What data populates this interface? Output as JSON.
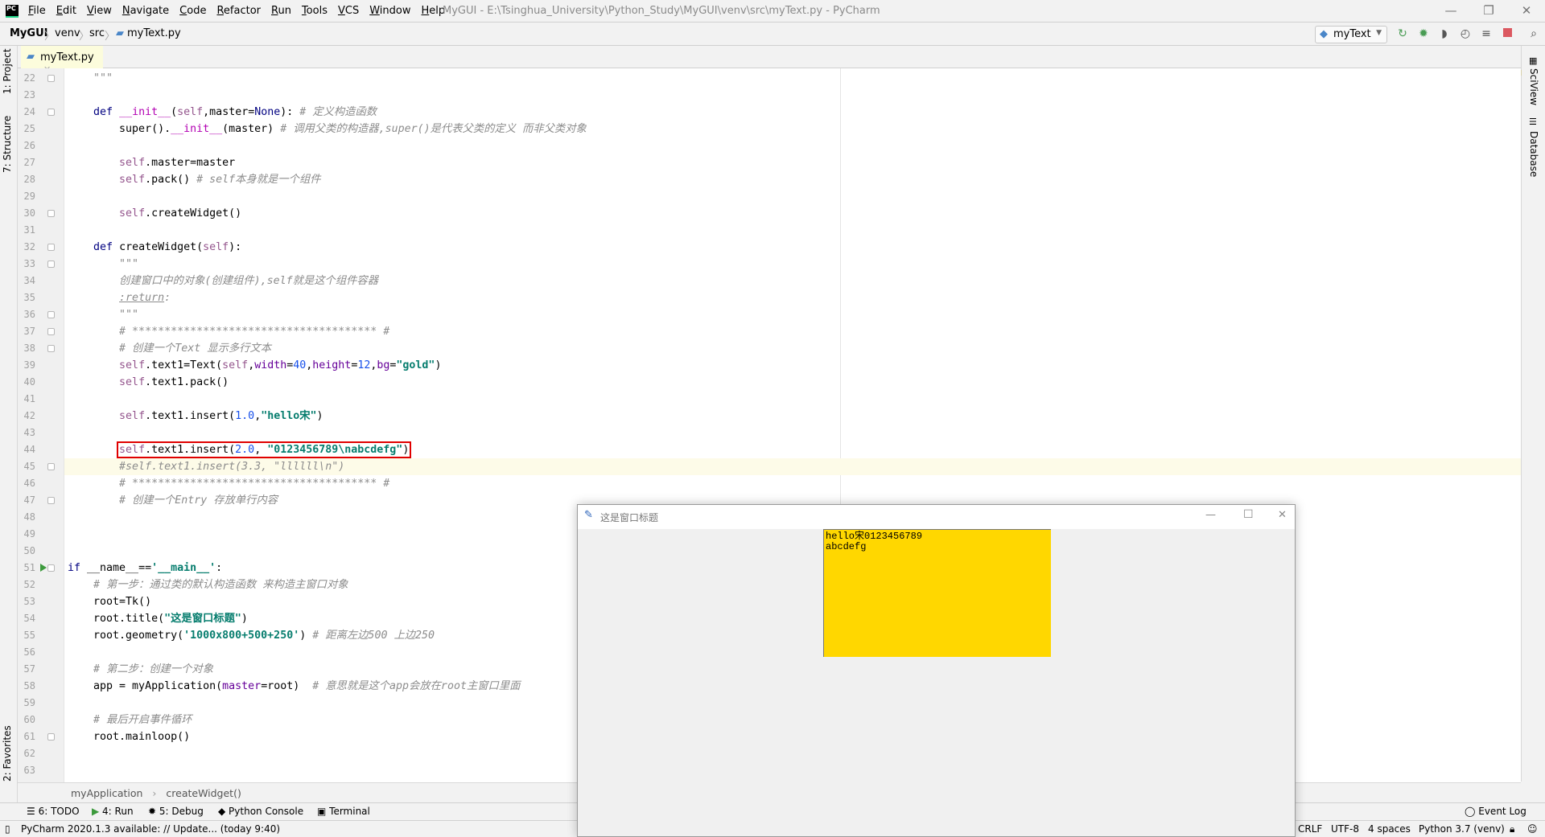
{
  "menubar": {
    "items": [
      "File",
      "Edit",
      "View",
      "Navigate",
      "Code",
      "Refactor",
      "Run",
      "Tools",
      "VCS",
      "Window",
      "Help"
    ],
    "window_title": "MyGUI - E:\\Tsinghua_University\\Python_Study\\MyGUI\\venv\\src\\myText.py - PyCharm"
  },
  "navbar": {
    "breadcrumb": [
      "MyGUI",
      "venv",
      "src",
      "myText.py"
    ],
    "run_config": "myText",
    "icons": [
      "rerun-icon",
      "debug-icon",
      "coverage-icon",
      "profile-icon",
      "concurrency-icon",
      "stop-icon",
      "search-icon"
    ]
  },
  "tab": {
    "label": "myText.py"
  },
  "left_strip": {
    "project": "1: Project",
    "structure": "7: Structure",
    "favorites": "2: Favorites"
  },
  "right_strip": {
    "sciview": "SciView",
    "database": "Database"
  },
  "editor": {
    "current_line": 45,
    "highlighted_line": 44,
    "lines": [
      {
        "n": 22,
        "fold": true,
        "tokens": [
          [
            "doc",
            "    \"\"\""
          ]
        ]
      },
      {
        "n": 23,
        "tokens": []
      },
      {
        "n": 24,
        "fold": true,
        "tokens": [
          [
            "",
            "    "
          ],
          [
            "kw",
            "def"
          ],
          [
            "",
            " "
          ],
          [
            "dunder",
            "__init__"
          ],
          [
            "",
            "("
          ],
          [
            "self",
            "self"
          ],
          [
            "",
            ",master="
          ],
          [
            "none",
            "None"
          ],
          [
            "",
            "): "
          ],
          [
            "cmt",
            "# 定义构造函数"
          ]
        ]
      },
      {
        "n": 25,
        "tokens": [
          [
            "",
            "        super()."
          ],
          [
            "dunder",
            "__init__"
          ],
          [
            "",
            "(master) "
          ],
          [
            "cmt",
            "# 调用父类的构造器,super()是代表父类的定义 而非父类对象"
          ]
        ]
      },
      {
        "n": 26,
        "tokens": []
      },
      {
        "n": 27,
        "tokens": [
          [
            "",
            "        "
          ],
          [
            "self",
            "self"
          ],
          [
            "",
            ".master=master"
          ]
        ]
      },
      {
        "n": 28,
        "tokens": [
          [
            "",
            "        "
          ],
          [
            "self",
            "self"
          ],
          [
            "",
            ".pack() "
          ],
          [
            "cmt",
            "# self本身就是一个组件"
          ]
        ]
      },
      {
        "n": 29,
        "tokens": []
      },
      {
        "n": 30,
        "fold": true,
        "tokens": [
          [
            "",
            "        "
          ],
          [
            "self",
            "self"
          ],
          [
            "",
            ".createWidget()"
          ]
        ]
      },
      {
        "n": 31,
        "tokens": []
      },
      {
        "n": 32,
        "fold": true,
        "tokens": [
          [
            "",
            "    "
          ],
          [
            "kw",
            "def"
          ],
          [
            "",
            " createWidget("
          ],
          [
            "self",
            "self"
          ],
          [
            "",
            "):"
          ]
        ]
      },
      {
        "n": 33,
        "fold": true,
        "tokens": [
          [
            "doc",
            "        \"\"\""
          ]
        ]
      },
      {
        "n": 34,
        "tokens": [
          [
            "doc",
            "        创建窗口中的对象(创建组件),self就是这个组件容器"
          ]
        ]
      },
      {
        "n": 35,
        "tokens": [
          [
            "",
            "        "
          ],
          [
            "doctag",
            ":return"
          ],
          [
            "doc",
            ":"
          ]
        ]
      },
      {
        "n": 36,
        "fold": true,
        "tokens": [
          [
            "doc",
            "        \"\"\""
          ]
        ]
      },
      {
        "n": 37,
        "fold": true,
        "tokens": [
          [
            "cmt",
            "        # ************************************** #"
          ]
        ]
      },
      {
        "n": 38,
        "fold": true,
        "tokens": [
          [
            "cmt",
            "        # 创建一个Text 显示多行文本"
          ]
        ]
      },
      {
        "n": 39,
        "tokens": [
          [
            "",
            "        "
          ],
          [
            "self",
            "self"
          ],
          [
            "",
            ".text1=Text("
          ],
          [
            "self",
            "self"
          ],
          [
            "",
            ","
          ],
          [
            "kwarg",
            "width"
          ],
          [
            "",
            "="
          ],
          [
            "num_",
            "40"
          ],
          [
            "",
            ","
          ],
          [
            "kwarg",
            "height"
          ],
          [
            "",
            "="
          ],
          [
            "num_",
            "12"
          ],
          [
            "",
            ","
          ],
          [
            "kwarg",
            "bg"
          ],
          [
            "",
            "="
          ],
          [
            "str",
            "\"gold\""
          ],
          [
            "",
            ")"
          ]
        ]
      },
      {
        "n": 40,
        "tokens": [
          [
            "",
            "        "
          ],
          [
            "self",
            "self"
          ],
          [
            "",
            ".text1.pack()"
          ]
        ]
      },
      {
        "n": 41,
        "tokens": []
      },
      {
        "n": 42,
        "tokens": [
          [
            "",
            "        "
          ],
          [
            "self",
            "self"
          ],
          [
            "",
            ".text1.insert("
          ],
          [
            "num_",
            "1.0"
          ],
          [
            "",
            ","
          ],
          [
            "str",
            "\"hello宋\""
          ],
          [
            "",
            ")"
          ]
        ]
      },
      {
        "n": 43,
        "tokens": []
      },
      {
        "n": 44,
        "tokens": [
          [
            "",
            "        "
          ],
          [
            "self",
            "self"
          ],
          [
            "",
            ".text1.insert("
          ],
          [
            "num_",
            "2.0"
          ],
          [
            "",
            ", "
          ],
          [
            "str",
            "\"0123456789\\nabcdefg\""
          ],
          [
            "",
            ")"
          ]
        ]
      },
      {
        "n": 45,
        "fold": true,
        "tokens": [
          [
            "cmt",
            "        #self.text1.insert(3.3, \"llllll\\n\")"
          ]
        ]
      },
      {
        "n": 46,
        "tokens": [
          [
            "cmt",
            "        # ************************************** #"
          ]
        ]
      },
      {
        "n": 47,
        "fold": true,
        "tokens": [
          [
            "cmt",
            "        # 创建一个Entry 存放单行内容"
          ]
        ]
      },
      {
        "n": 48,
        "tokens": []
      },
      {
        "n": 49,
        "tokens": []
      },
      {
        "n": 50,
        "tokens": []
      },
      {
        "n": 51,
        "fold": true,
        "run": true,
        "tokens": [
          [
            "kw",
            "if"
          ],
          [
            "",
            " __name__=="
          ],
          [
            "str",
            "'__main__'"
          ],
          [
            "",
            ":"
          ]
        ]
      },
      {
        "n": 52,
        "tokens": [
          [
            "cmt",
            "    # 第一步：通过类的默认构造函数 来构造主窗口对象"
          ]
        ]
      },
      {
        "n": 53,
        "tokens": [
          [
            "",
            "    root=Tk()"
          ]
        ]
      },
      {
        "n": 54,
        "tokens": [
          [
            "",
            "    root.title("
          ],
          [
            "str",
            "\"这是窗口标题\""
          ],
          [
            "",
            ")"
          ]
        ]
      },
      {
        "n": 55,
        "tokens": [
          [
            "",
            "    root.geometry("
          ],
          [
            "str",
            "'1000x800+500+250'"
          ],
          [
            "",
            ") "
          ],
          [
            "cmt",
            "# 距离左边500 上边250"
          ]
        ]
      },
      {
        "n": 56,
        "tokens": []
      },
      {
        "n": 57,
        "tokens": [
          [
            "cmt",
            "    # 第二步：创建一个对象"
          ]
        ]
      },
      {
        "n": 58,
        "tokens": [
          [
            "",
            "    app = myApplication("
          ],
          [
            "kwarg",
            "master"
          ],
          [
            "",
            "=root)  "
          ],
          [
            "cmt",
            "# 意思就是这个app会放在root主窗口里面"
          ]
        ]
      },
      {
        "n": 59,
        "tokens": []
      },
      {
        "n": 60,
        "tokens": [
          [
            "cmt",
            "    # 最后开启事件循环"
          ]
        ]
      },
      {
        "n": 61,
        "fold": true,
        "tokens": [
          [
            "",
            "    root.mainloop()"
          ]
        ]
      },
      {
        "n": 62,
        "tokens": []
      },
      {
        "n": 63,
        "tokens": []
      }
    ]
  },
  "bottom_breadcrumb": {
    "class": "myApplication",
    "method": "createWidget()"
  },
  "tool_windows": {
    "todo": "6: TODO",
    "run": "4: Run",
    "debug": "5: Debug",
    "console": "Python Console",
    "terminal": "Terminal",
    "event_log": "Event Log"
  },
  "status": {
    "message": "PyCharm 2020.1.3 available: // Update... (today 9:40)",
    "line_sep": "CRLF",
    "encoding": "UTF-8",
    "indent": "4 spaces",
    "interpreter": "Python 3.7 (venv)"
  },
  "tk_window": {
    "title": "这是窗口标题",
    "text_bg": "#FFD700",
    "text_lines": [
      "hello宋0123456789",
      "abcdefg"
    ]
  }
}
